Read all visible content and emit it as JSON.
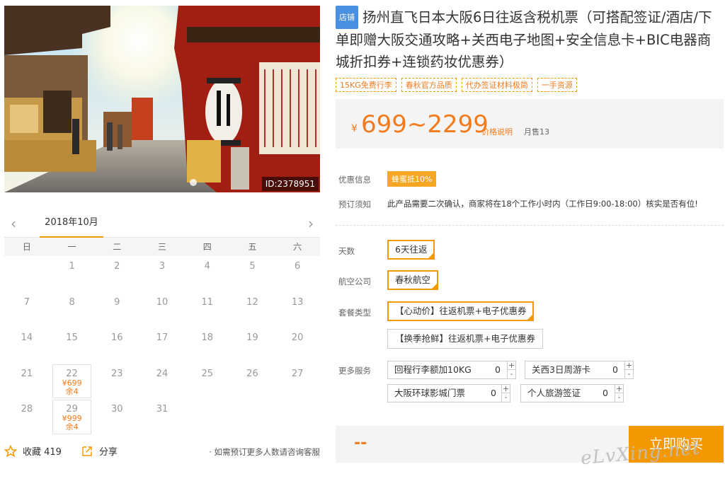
{
  "hero": {
    "id_label": "ID:2378951"
  },
  "calendar": {
    "month": "2018年10月",
    "weekdays": [
      "日",
      "一",
      "二",
      "三",
      "四",
      "五",
      "六"
    ],
    "prev_icon": "chevron-left-icon",
    "next_icon": "chevron-right-icon",
    "weeks": [
      [
        {
          "d": ""
        },
        {
          "d": "1"
        },
        {
          "d": "2"
        },
        {
          "d": "3"
        },
        {
          "d": "4"
        },
        {
          "d": "5"
        },
        {
          "d": "6"
        }
      ],
      [
        {
          "d": "7"
        },
        {
          "d": "8"
        },
        {
          "d": "9"
        },
        {
          "d": "10"
        },
        {
          "d": "11"
        },
        {
          "d": "12"
        },
        {
          "d": "13"
        }
      ],
      [
        {
          "d": "14"
        },
        {
          "d": "15"
        },
        {
          "d": "16"
        },
        {
          "d": "17"
        },
        {
          "d": "18"
        },
        {
          "d": "19"
        },
        {
          "d": "20"
        }
      ],
      [
        {
          "d": "21"
        },
        {
          "d": "22",
          "price": "¥699",
          "left": "余4"
        },
        {
          "d": "23"
        },
        {
          "d": "24"
        },
        {
          "d": "25"
        },
        {
          "d": "26"
        },
        {
          "d": "27"
        }
      ],
      [
        {
          "d": "28"
        },
        {
          "d": "29",
          "price": "¥999",
          "left": "余4"
        },
        {
          "d": "30"
        },
        {
          "d": "31"
        },
        {
          "d": ""
        },
        {
          "d": ""
        },
        {
          "d": ""
        }
      ]
    ]
  },
  "footer": {
    "favorite_label": "收藏 419",
    "share_label": "分享",
    "note": "· 如需预订更多人数请咨询客服"
  },
  "product": {
    "shop_badge": "店铺",
    "title": "扬州直飞日本大阪6日往返含税机票（可搭配签证/酒店/下单即赠大阪交通攻略+关西电子地图+安全信息卡+BIC电器商城折扣券+连锁药妆优惠券）",
    "tags": [
      "15KG免费行李",
      "春秋官方品质",
      "代办签证材料极简",
      "一手资源"
    ],
    "currency": "¥",
    "price_range": "699~2299",
    "price_explain": "价格说明",
    "monthly_sales": "月售13",
    "promo_label": "优惠信息",
    "promo_badge": "蜂蜜抵10%",
    "notice_label": "预订须知",
    "notice_text": "此产品需要二次确认，商家将在18个工作小时内（工作日9:00-18:00）核实是否有位!"
  },
  "options": {
    "days_label": "天数",
    "days_value": "6天往返",
    "airline_label": "航空公司",
    "airline_value": "春秋航空",
    "package_label": "套餐类型",
    "package_options": [
      "【心动价】往返机票+电子优惠券",
      "【换季抢鲜】往返机票+电子优惠券"
    ],
    "services_label": "更多服务",
    "services": [
      {
        "name": "回程行李额加10KG",
        "qty": "0"
      },
      {
        "name": "关西3日周游卡",
        "qty": "0"
      },
      {
        "name": "大阪环球影城门票",
        "qty": "0"
      },
      {
        "name": "个人旅游签证",
        "qty": "0"
      }
    ],
    "plus": "+",
    "minus": "-"
  },
  "buy": {
    "total": "--",
    "button": "立即购买"
  },
  "watermark": "eLvXing.net",
  "colors": {
    "accent": "#f39800",
    "price": "#f27b1e",
    "badge_blue": "#4a90e2"
  }
}
